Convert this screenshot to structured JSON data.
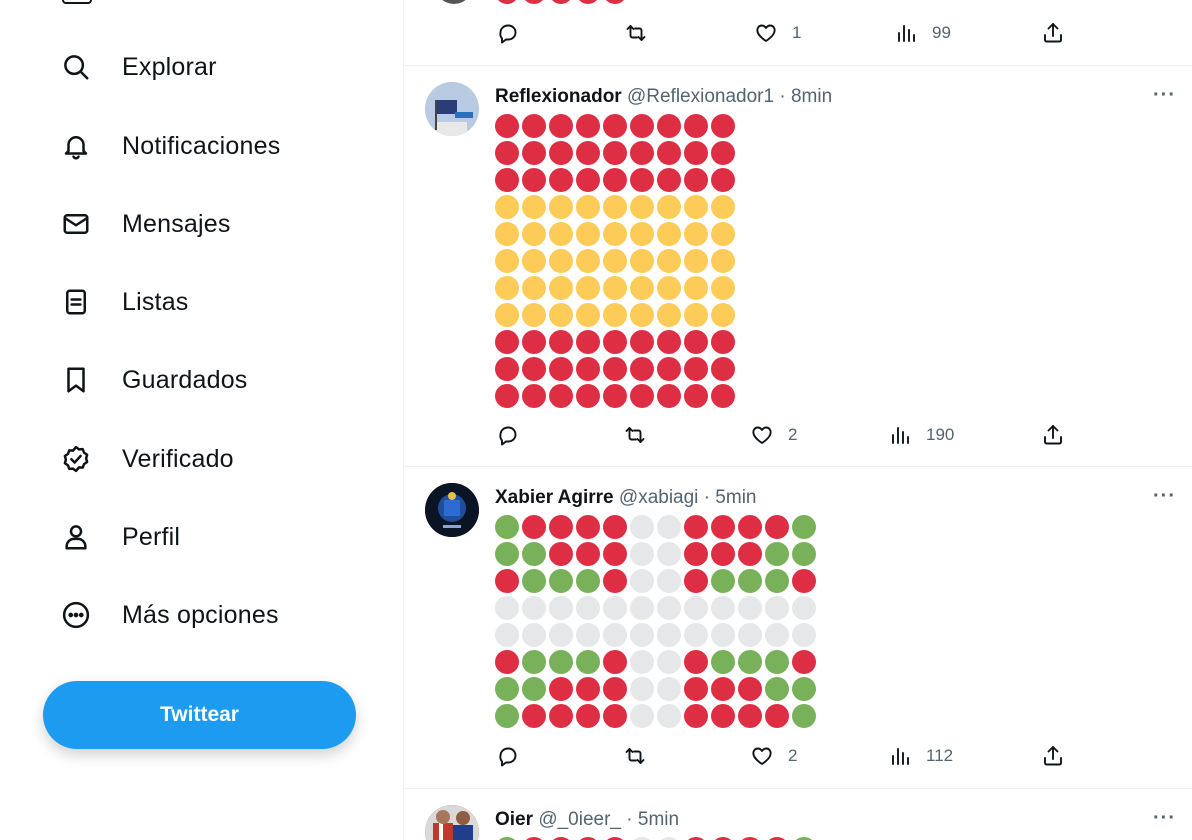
{
  "sidebar": {
    "items": [
      {
        "label": "Explorar",
        "icon": "search-icon"
      },
      {
        "label": "Notificaciones",
        "icon": "bell-icon"
      },
      {
        "label": "Mensajes",
        "icon": "envelope-icon"
      },
      {
        "label": "Listas",
        "icon": "list-icon"
      },
      {
        "label": "Guardados",
        "icon": "bookmark-icon"
      },
      {
        "label": "Verificado",
        "icon": "verified-badge-icon"
      },
      {
        "label": "Perfil",
        "icon": "person-icon"
      },
      {
        "label": "Más opciones",
        "icon": "more-circle-icon"
      }
    ],
    "tweet_button": "Twittear"
  },
  "colors": {
    "accent": "#1d9bf0",
    "red": "#dd2e44",
    "yellow": "#fdcb58",
    "green": "#78b159",
    "white_circle": "#e6e7e8",
    "muted_text": "#536471"
  },
  "feed": {
    "partial_tweet": {
      "likes": "1",
      "views": "99"
    },
    "tweets": [
      {
        "name": "Reflexionador",
        "handle": "@Reflexionador1",
        "time": "8min",
        "more": "···",
        "emoji_grid": [
          "rrrrrrrrr",
          "rrrrrrrrr",
          "rrrrrrrrr",
          "yyyyyyyyy",
          "yyyyyyyyy",
          "yyyyyyyyy",
          "yyyyyyyyy",
          "yyyyyyyyy",
          "rrrrrrrrr",
          "rrrrrrrrr",
          "rrrrrrrrr"
        ],
        "likes": "2",
        "views": "190"
      },
      {
        "name": "Xabier Agirre",
        "handle": "@xabiagi",
        "time": "5min",
        "more": "···",
        "emoji_grid": [
          "grrrrwwrrrrg",
          "ggrrrwwrrrgg",
          "rgggrwwrgggr",
          "wwwwwwwwwwww",
          "wwwwwwwwwwww",
          "rgggrwwrgggr",
          "ggrrrwwrrrgg",
          "grrrrwwrrrrg"
        ],
        "likes": "2",
        "views": "112"
      },
      {
        "name": "Oier",
        "handle": "@_0ieer_",
        "time": "5min",
        "more": "···"
      }
    ]
  }
}
